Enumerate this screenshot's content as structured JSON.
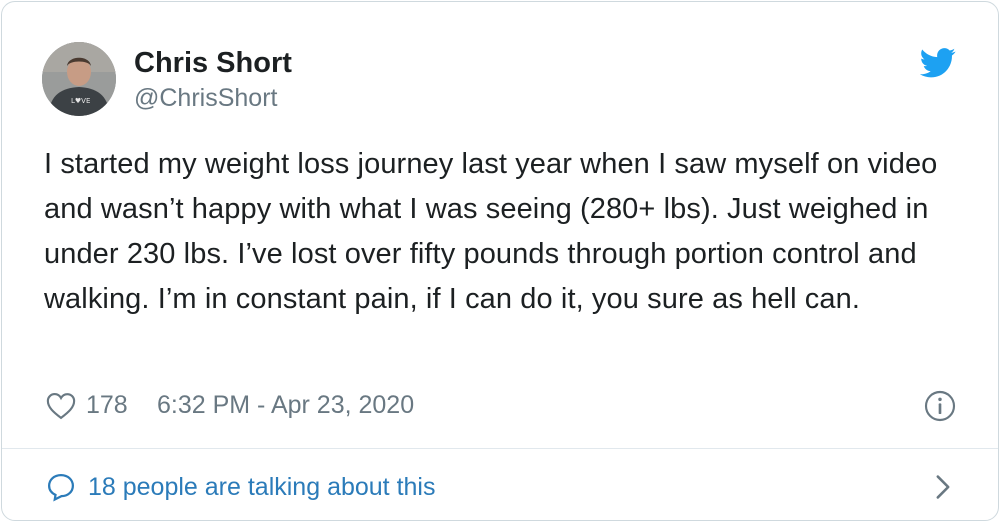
{
  "tweet": {
    "author": {
      "name": "Chris Short",
      "handle": "@ChrisShort"
    },
    "text": "I started my weight loss journey last year when I saw myself on video and wasn’t happy with what I was seeing (280+ lbs). Just weighed in under 230 lbs. I’ve lost over fifty pounds through portion control and walking. I’m in constant pain, if I can do it, you sure as hell can.",
    "likes": "178",
    "timestamp": "6:32 PM - Apr 23, 2020",
    "footer_text": "18 people are talking about this"
  },
  "icons": {
    "brand": "twitter-bird-icon",
    "like": "heart-icon",
    "info": "info-icon",
    "reply": "speech-bubble-icon",
    "more": "chevron-right-icon"
  },
  "colors": {
    "brand": "#1da1f2",
    "link": "#2b7bb9",
    "text": "#1c2022",
    "muted": "#697882",
    "border": "#cfd9de"
  }
}
